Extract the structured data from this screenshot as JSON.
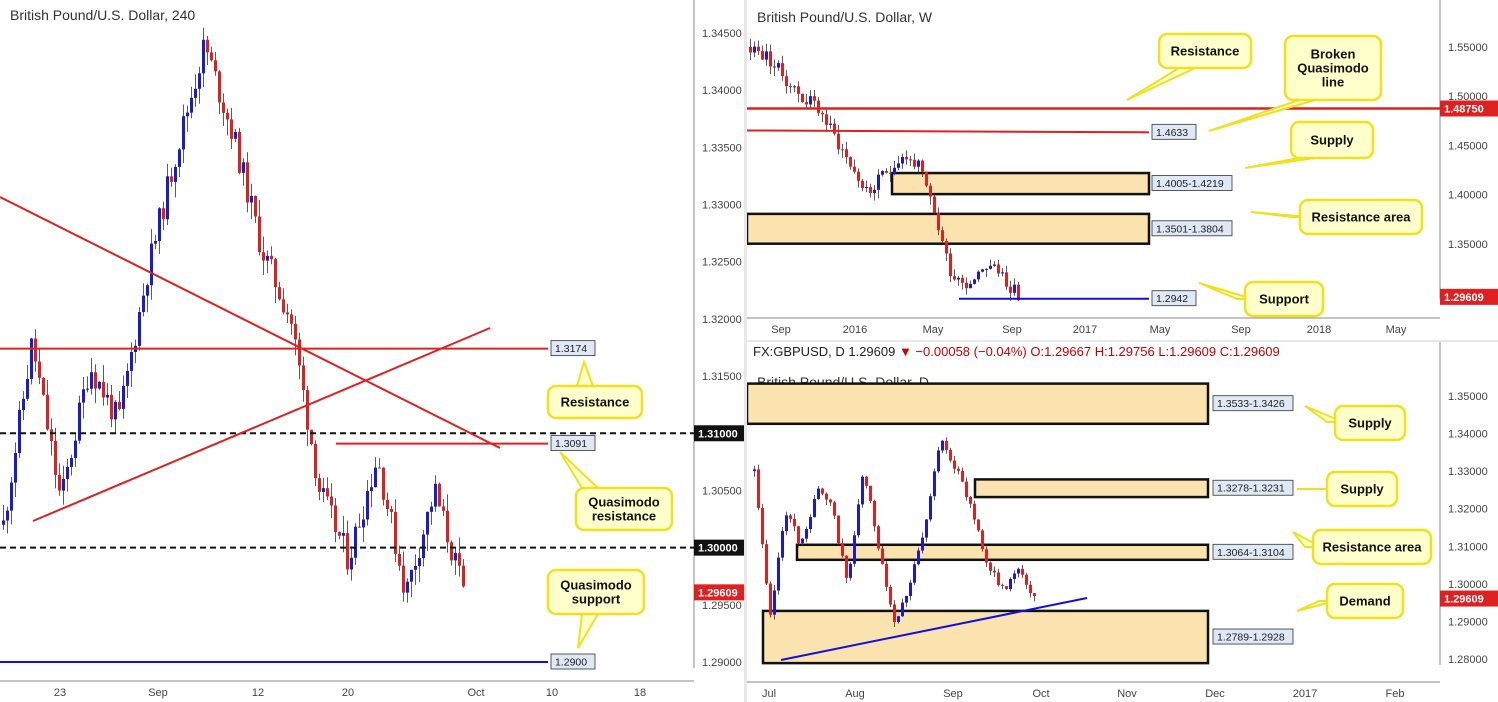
{
  "charts": {
    "h4": {
      "title": "British Pound/U.S. Dollar, 240",
      "price_ticks": [
        "1.34500",
        "1.34000",
        "1.33500",
        "1.33000",
        "1.32500",
        "1.32000",
        "1.31500",
        "1.31000",
        "1.30500",
        "1.30000",
        "1.29500",
        "1.29000"
      ],
      "date_ticks": [
        "23",
        "Sep",
        "12",
        "20",
        "Oct",
        "10",
        "18"
      ],
      "current_price": "1.29609",
      "levels": [
        {
          "label": "1.3174",
          "value": 1.3174,
          "color": "#e02020"
        },
        {
          "label": "1.3091",
          "value": 1.3091,
          "color": "#e02020"
        },
        {
          "label": "1.2900",
          "value": 1.29,
          "color": "#1010e0"
        }
      ],
      "round_numbers": [
        "1.31000",
        "1.30000"
      ],
      "callouts": [
        "Resistance",
        "Quasimodo resistance",
        "Quasimodo support"
      ]
    },
    "weekly": {
      "title": "British Pound/U.S. Dollar, W",
      "price_ticks": [
        "1.55000",
        "1.50000",
        "1.45000",
        "1.40000",
        "1.35000",
        "1.30000"
      ],
      "date_ticks": [
        "Sep",
        "2016",
        "May",
        "Sep",
        "2017",
        "May",
        "Sep",
        "2018",
        "May"
      ],
      "current_price": "1.29609",
      "resistance_price": "1.48750",
      "zones": [
        {
          "label": "1.4005-1.4219",
          "low": 1.4005,
          "high": 1.4219
        },
        {
          "label": "1.3501-1.3804",
          "low": 1.3501,
          "high": 1.3804
        }
      ],
      "levels": [
        {
          "label": "1.4633",
          "value": 1.4633,
          "color": "#e02020"
        },
        {
          "label": "1.2942",
          "value": 1.2942,
          "color": "#1010e0"
        }
      ],
      "callouts": [
        "Resistance",
        "Broken Quasimodo line",
        "Supply",
        "Resistance area",
        "Support"
      ]
    },
    "daily": {
      "title": "British Pound/U.S. Dollar, D",
      "header": {
        "symbol": "FX:GBPUSD, D",
        "last": "1.29609",
        "change": "−0.00058 (−0.04%)",
        "o": "O:1.29667",
        "h": "H:1.29756",
        "l": "L:1.29609",
        "c": "C:1.29609"
      },
      "price_ticks": [
        "1.35000",
        "1.34000",
        "1.33000",
        "1.32000",
        "1.31000",
        "1.30000",
        "1.29000",
        "1.28000"
      ],
      "date_ticks": [
        "Jul",
        "Aug",
        "Sep",
        "Oct",
        "Nov",
        "Dec",
        "2017",
        "Feb"
      ],
      "current_price": "1.29609",
      "zones": [
        {
          "label": "1.3533-1.3426",
          "low": 1.3426,
          "high": 1.3533
        },
        {
          "label": "1.3278-1.3231",
          "low": 1.3231,
          "high": 1.3278
        },
        {
          "label": "1.3064-1.3104",
          "low": 1.3064,
          "high": 1.3104
        },
        {
          "label": "1.2789-1.2928",
          "low": 1.2789,
          "high": 1.2928
        }
      ],
      "callouts": [
        "Supply",
        "Supply",
        "Resistance area",
        "Demand"
      ]
    }
  },
  "chart_data": [
    {
      "type": "line",
      "title": "British Pound/U.S. Dollar, 240",
      "x": [
        "23",
        "Sep",
        "12",
        "20",
        "Oct"
      ],
      "series": [
        {
          "values": [
            1.302,
            1.318,
            1.304,
            1.316,
            1.311,
            1.324,
            1.3345,
            1.344,
            1.336,
            1.326,
            1.32,
            1.305,
            1.299,
            1.308,
            1.296,
            1.305,
            1.2961
          ]
        }
      ],
      "ylim": [
        1.288,
        1.3465
      ]
    },
    {
      "type": "line",
      "title": "British Pound/U.S. Dollar, W",
      "series": [
        {
          "values": [
            1.55,
            1.54,
            1.52,
            1.5,
            1.49,
            1.46,
            1.43,
            1.4,
            1.42,
            1.44,
            1.43,
            1.38,
            1.32,
            1.31,
            1.33,
            1.32,
            1.2961
          ]
        }
      ],
      "ylim": [
        1.27,
        1.57
      ]
    },
    {
      "type": "line",
      "title": "British Pound/U.S. Dollar, D",
      "series": [
        {
          "values": [
            1.33,
            1.29,
            1.32,
            1.31,
            1.325,
            1.32,
            1.3,
            1.33,
            1.31,
            1.29,
            1.3,
            1.315,
            1.34,
            1.33,
            1.32,
            1.305,
            1.298,
            1.305,
            1.2961
          ]
        }
      ],
      "ylim": [
        1.275,
        1.356
      ]
    }
  ]
}
